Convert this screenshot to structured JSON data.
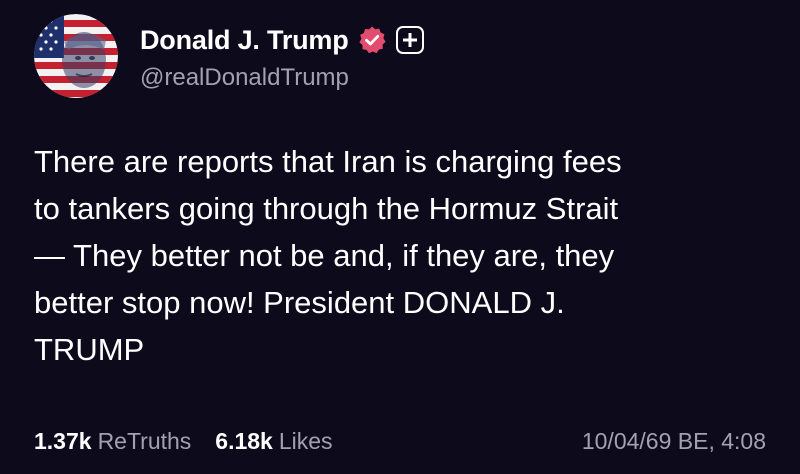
{
  "post": {
    "author": {
      "display_name": "Donald J. Trump",
      "handle": "@realDonaldTrump",
      "verified_icon": "verified-badge-icon",
      "follow_icon": "plus-icon",
      "avatar_icon": "profile-avatar"
    },
    "text": "There are reports that Iran is charging fees\nto tankers going through the Hormuz Strait\n— They better not be and, if they are, they\nbetter stop now! President DONALD J.\nTRUMP",
    "stats": {
      "retruths_count": "1.37k",
      "retruths_label": "ReTruths",
      "likes_count": "6.18k",
      "likes_label": "Likes"
    },
    "timestamp": "10/04/69 BE, 4:08"
  },
  "colors": {
    "background": "#0d0a1c",
    "text_primary": "#ffffff",
    "text_secondary": "#a3a0b3",
    "verified_badge": "#e24c6f"
  }
}
